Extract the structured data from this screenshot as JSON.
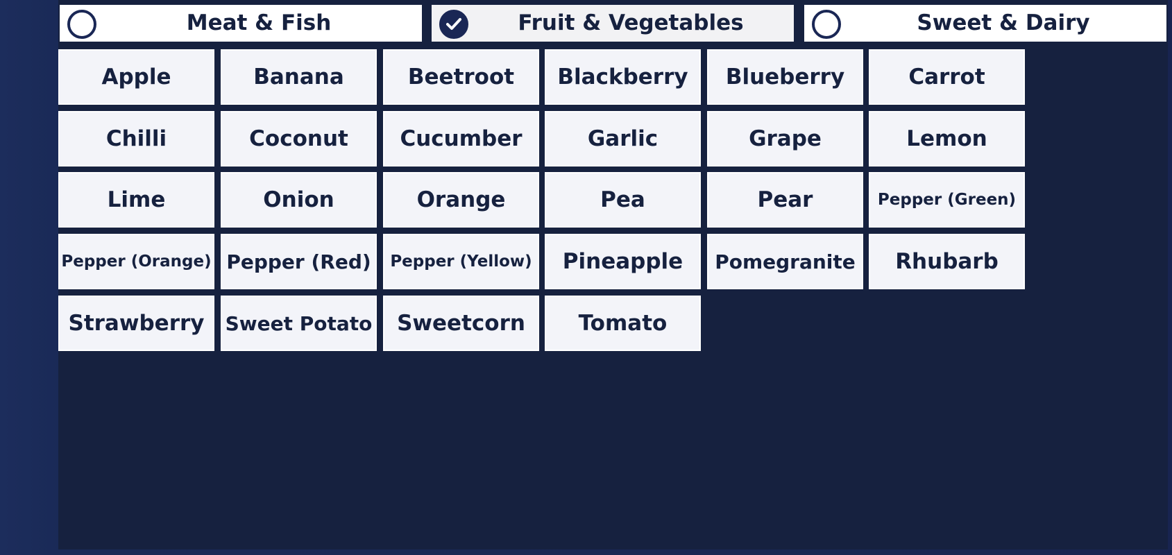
{
  "tabs": [
    {
      "label": "Meat & Fish",
      "selected": false
    },
    {
      "label": "Fruit & Vegetables",
      "selected": true
    },
    {
      "label": "Sweet & Dairy",
      "selected": false
    }
  ],
  "items": [
    "Apple",
    "Banana",
    "Beetroot",
    "Blackberry",
    "Blueberry",
    "Carrot",
    "Chilli",
    "Coconut",
    "Cucumber",
    "Garlic",
    "Grape",
    "Lemon",
    "Lime",
    "Onion",
    "Orange",
    "Pea",
    "Pear",
    "Pepper (Green)",
    "Pepper (Orange)",
    "Pepper (Red)",
    "Pepper (Yellow)",
    "Pineapple",
    "Pomegranite",
    "Rhubarb",
    "Strawberry",
    "Sweet Potato",
    "Sweetcorn",
    "Tomato"
  ],
  "icons": {
    "unselected": "radio-empty-icon",
    "selected": "radio-check-icon"
  },
  "colors": {
    "navy": "#16213f",
    "button_bg": "#f3f4f9"
  }
}
